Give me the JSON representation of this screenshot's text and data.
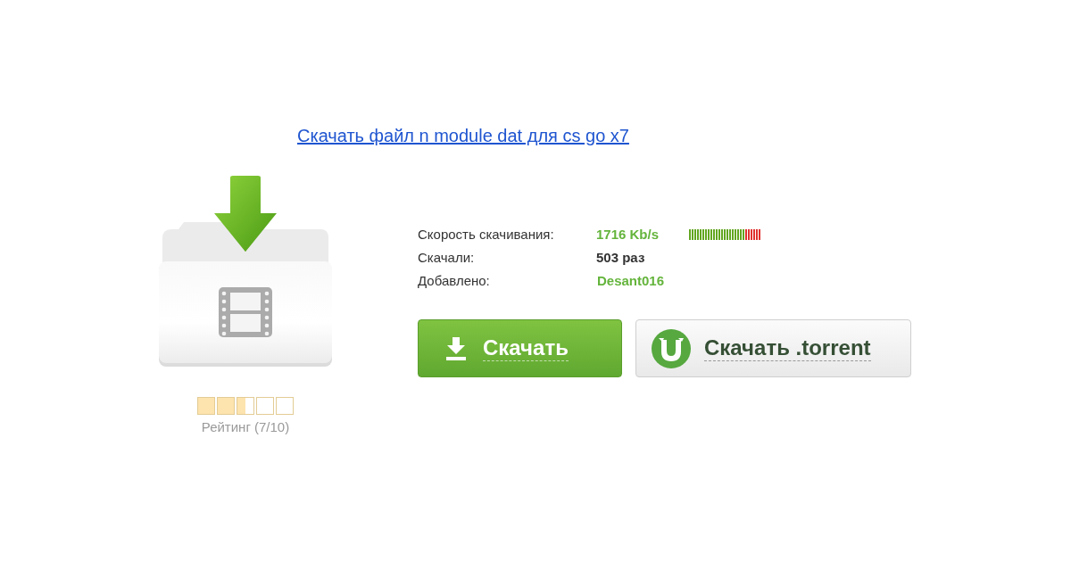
{
  "link": {
    "text": "Скачать файл n module dat для cs go x7"
  },
  "file": {
    "rating": {
      "stars": 2.5,
      "label": "Рейтинг (7/10)"
    }
  },
  "info": [
    {
      "kind": "speed",
      "label": "Скорость скачивания:",
      "value": "1716 Kb/s",
      "level": 0.77
    },
    {
      "kind": "count",
      "label": "Скачали:",
      "value": "503 раз"
    },
    {
      "kind": "user",
      "label": "Добавлено:",
      "value": "Desant016"
    }
  ],
  "buttons": [
    {
      "kind": "primary",
      "label": "Скачать"
    },
    {
      "kind": "torrent",
      "label": "Скачать .torrent"
    }
  ]
}
